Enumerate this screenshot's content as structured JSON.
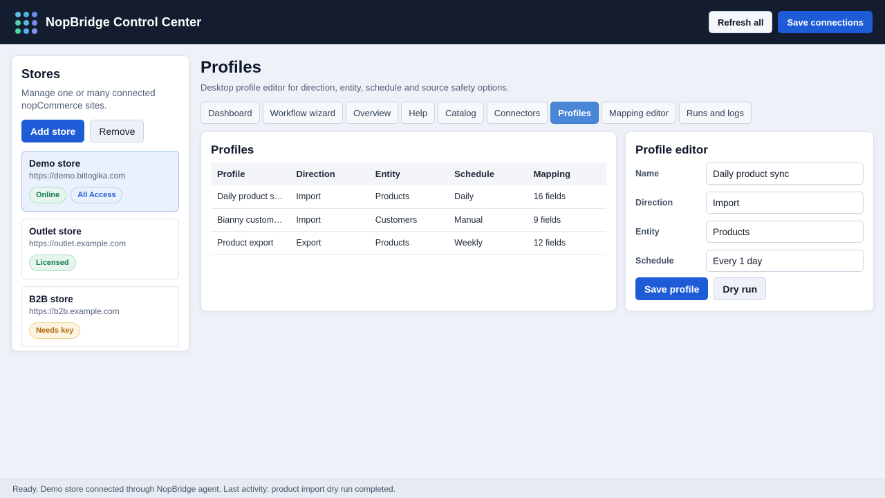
{
  "app": {
    "title": "NopBridge Control Center",
    "refresh_label": "Refresh all",
    "save_connections_label": "Save connections"
  },
  "sidebar": {
    "title": "Stores",
    "description": "Manage one or many connected nopCommerce sites.",
    "add_label": "Add store",
    "remove_label": "Remove",
    "stores": [
      {
        "name": "Demo store",
        "url": "https://demo.bitlogika.com",
        "badges": [
          "Online",
          "All Access"
        ]
      },
      {
        "name": "Outlet store",
        "url": "https://outlet.example.com",
        "badges": [
          "Licensed"
        ]
      },
      {
        "name": "B2B store",
        "url": "https://b2b.example.com",
        "badges": [
          "Needs key"
        ]
      }
    ]
  },
  "page": {
    "title": "Profiles",
    "description": "Desktop profile editor for direction, entity, schedule and source safety options."
  },
  "tabs": [
    "Dashboard",
    "Workflow wizard",
    "Overview",
    "Help",
    "Catalog",
    "Connectors",
    "Profiles",
    "Mapping editor",
    "Runs and logs"
  ],
  "active_tab": "Profiles",
  "profiles": {
    "title": "Profiles",
    "columns": [
      "Profile",
      "Direction",
      "Entity",
      "Schedule",
      "Mapping"
    ],
    "rows": [
      [
        "Daily product sync",
        "Import",
        "Products",
        "Daily",
        "16 fields"
      ],
      [
        "Bianny customers",
        "Import",
        "Customers",
        "Manual",
        "9 fields"
      ],
      [
        "Product export",
        "Export",
        "Products",
        "Weekly",
        "12 fields"
      ]
    ]
  },
  "editor": {
    "title": "Profile editor",
    "name_label": "Name",
    "name_value": "Daily product sync",
    "direction_label": "Direction",
    "direction_value": "Import",
    "entity_label": "Entity",
    "entity_value": "Products",
    "schedule_label": "Schedule",
    "schedule_value": "Every 1 day",
    "save_label": "Save profile",
    "dry_run_label": "Dry run"
  },
  "status": {
    "text": "Ready. Demo store connected through NopBridge agent. Last activity: product import dry run completed."
  },
  "colors": {
    "topbar": "#141d2f",
    "primary": "#1e5bd6",
    "active_tab": "#4a86d8",
    "online": "#0f7a4a",
    "access": "#1e5bd6",
    "needs_key": "#b06a05"
  }
}
